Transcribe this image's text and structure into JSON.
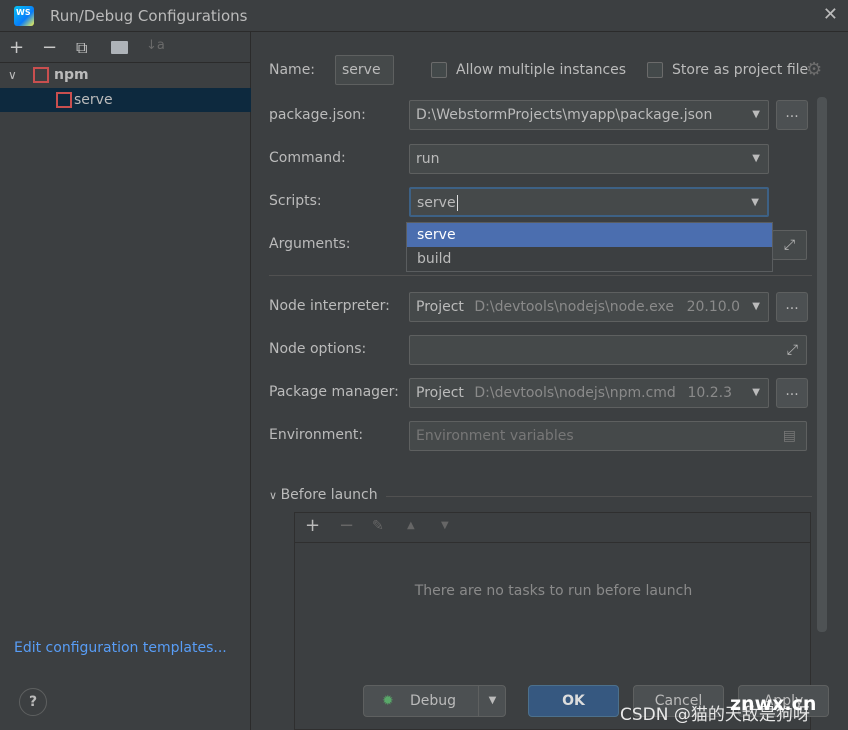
{
  "window": {
    "title": "Run/Debug Configurations",
    "logo": "WS"
  },
  "toolbar": {
    "add": "+",
    "remove": "−",
    "copy": "⧉",
    "folder": "folder-add",
    "sort": "↓a"
  },
  "tree": {
    "group": "npm",
    "item": "serve"
  },
  "edit_templates": "Edit configuration templates...",
  "form": {
    "name_label": "Name:",
    "name_value": "serve",
    "allow_multiple": "Allow multiple instances",
    "store_project": "Store as project file",
    "package_json_label": "package.json:",
    "package_json_value": "D:\\WebstormProjects\\myapp\\package.json",
    "command_label": "Command:",
    "command_value": "run",
    "scripts_label": "Scripts:",
    "scripts_value": "serve",
    "scripts_options": [
      "serve",
      "build"
    ],
    "arguments_label": "Arguments:",
    "node_interpreter_label": "Node interpreter:",
    "node_interpreter_kind": "Project",
    "node_interpreter_path": "D:\\devtools\\nodejs\\node.exe",
    "node_version": "20.10.0",
    "node_options_label": "Node options:",
    "package_manager_label": "Package manager:",
    "package_manager_kind": "Project",
    "package_manager_path": "D:\\devtools\\nodejs\\npm.cmd",
    "package_manager_version": "10.2.3",
    "environment_label": "Environment:",
    "environment_placeholder": "Environment variables",
    "before_launch": "Before launch",
    "no_tasks": "There are no tasks to run before launch"
  },
  "footer": {
    "help": "?",
    "debug": "Debug",
    "ok": "OK",
    "cancel": "Cancel",
    "apply": "Apply"
  },
  "watermark": "CSDN @猫的天敌是狗呀",
  "watermark2": "znwx.cn",
  "colors": {
    "accent": "#4b6eaf",
    "selection": "#0d293e",
    "npm": "#c94f4f"
  }
}
